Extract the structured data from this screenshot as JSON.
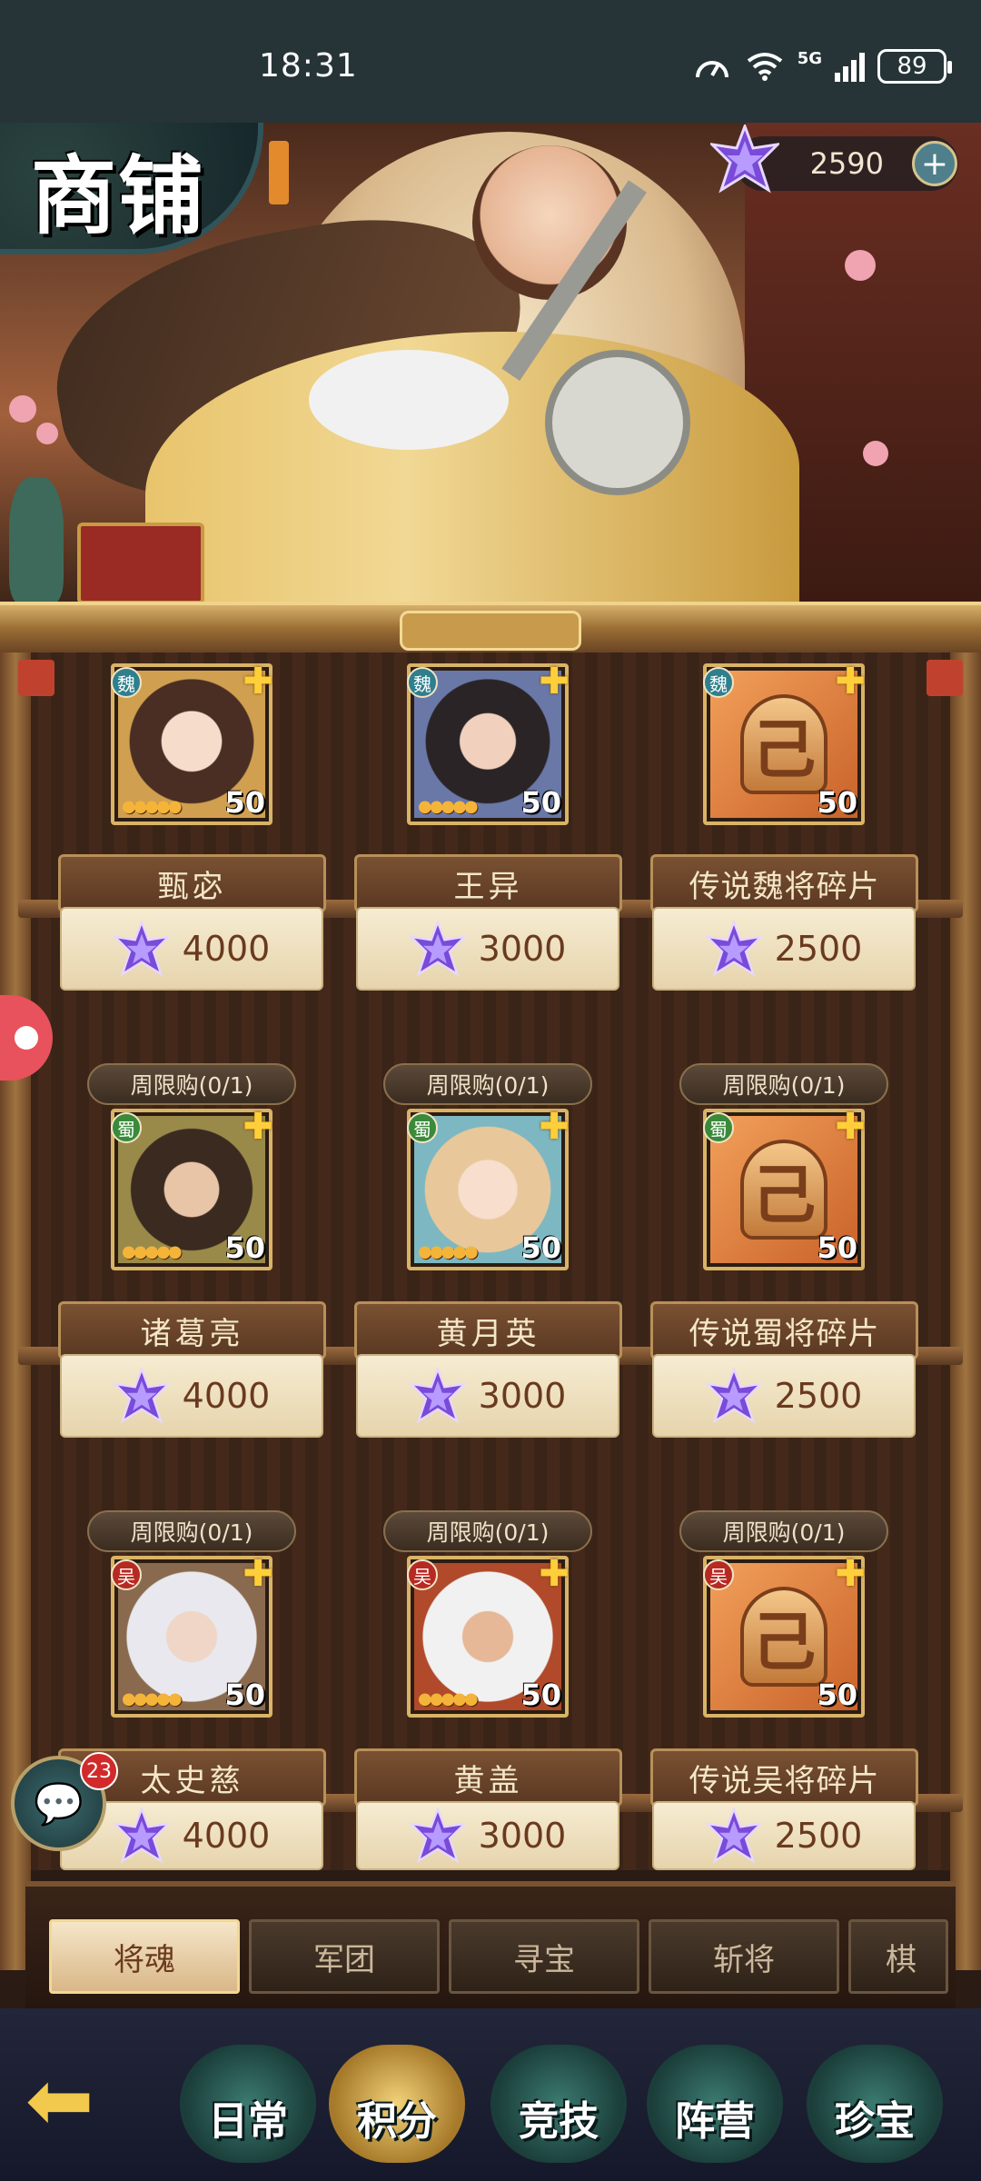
{
  "status": {
    "time": "18:31",
    "network": "5G",
    "battery": "89"
  },
  "header": {
    "title": "商铺",
    "currency_amount": "2590",
    "currency_icon": "star-gem-icon"
  },
  "shop_items": [
    {
      "faction": "魏",
      "name": "甄宓",
      "level": "50",
      "price": "4000",
      "kind": "hero"
    },
    {
      "faction": "魏",
      "name": "王异",
      "level": "50",
      "price": "3000",
      "kind": "hero"
    },
    {
      "faction": "魏",
      "name": "传说魏将碎片",
      "level": "50",
      "price": "2500",
      "kind": "shard"
    },
    {
      "limit": "周限购(0/1)",
      "faction": "蜀",
      "name": "诸葛亮",
      "level": "50",
      "price": "4000",
      "kind": "hero"
    },
    {
      "limit": "周限购(0/1)",
      "faction": "蜀",
      "name": "黄月英",
      "level": "50",
      "price": "3000",
      "kind": "hero"
    },
    {
      "limit": "周限购(0/1)",
      "faction": "蜀",
      "name": "传说蜀将碎片",
      "level": "50",
      "price": "2500",
      "kind": "shard"
    },
    {
      "limit": "周限购(0/1)",
      "faction": "吴",
      "name": "太史慈",
      "level": "50",
      "price": "4000",
      "kind": "hero"
    },
    {
      "limit": "周限购(0/1)",
      "faction": "吴",
      "name": "黄盖",
      "level": "50",
      "price": "3000",
      "kind": "hero"
    },
    {
      "limit": "周限购(0/1)",
      "faction": "吴",
      "name": "传说吴将碎片",
      "level": "50",
      "price": "2500",
      "kind": "shard"
    }
  ],
  "chat": {
    "badge": "23"
  },
  "tabs": [
    {
      "label": "将魂",
      "active": true
    },
    {
      "label": "军团"
    },
    {
      "label": "寻宝"
    },
    {
      "label": "斩将"
    },
    {
      "label": "棋"
    }
  ],
  "nav": [
    {
      "label": "日常"
    },
    {
      "label": "积分",
      "active": true
    },
    {
      "label": "竞技"
    },
    {
      "label": "阵营"
    },
    {
      "label": "珍宝"
    }
  ],
  "colors": {
    "wei": "#2f7f8d",
    "shu": "#3a8a3a",
    "wu": "#b72a22",
    "accent_gold": "#d9b366"
  }
}
